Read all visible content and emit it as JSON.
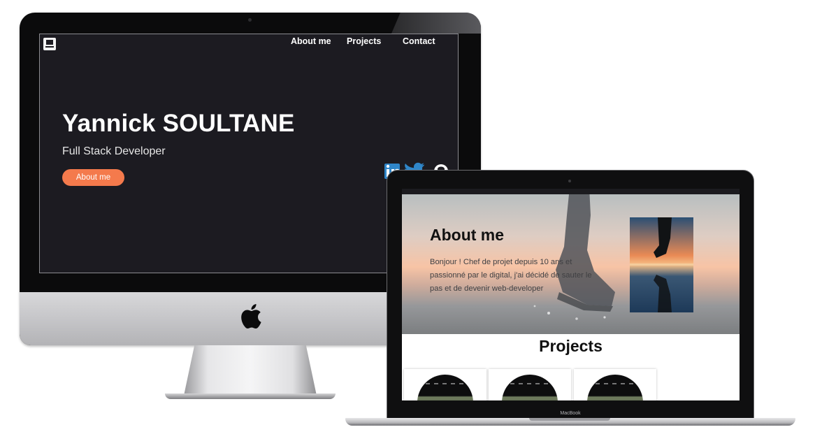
{
  "imac": {
    "nav": {
      "about_label": "About me",
      "projects_label": "Projects",
      "contact_label": "Contact"
    },
    "hero": {
      "name": "Yannick SOULTANE",
      "role": "Full Stack Developer",
      "button_label": "About me"
    },
    "social_icons": [
      "linkedin-icon",
      "twitter-icon",
      "github-icon"
    ],
    "accent_color": "#f47a4c",
    "background_color": "#1c1b21"
  },
  "macbook": {
    "about": {
      "title": "About me",
      "text": "Bonjour ! Chef de projet depuis 10 ans et passionné par le digital, j'ai décidé de sauter le pas et de devenir web-developer"
    },
    "projects": {
      "title": "Projects",
      "card_count_visible": 3
    },
    "device_label": "MacBook"
  }
}
